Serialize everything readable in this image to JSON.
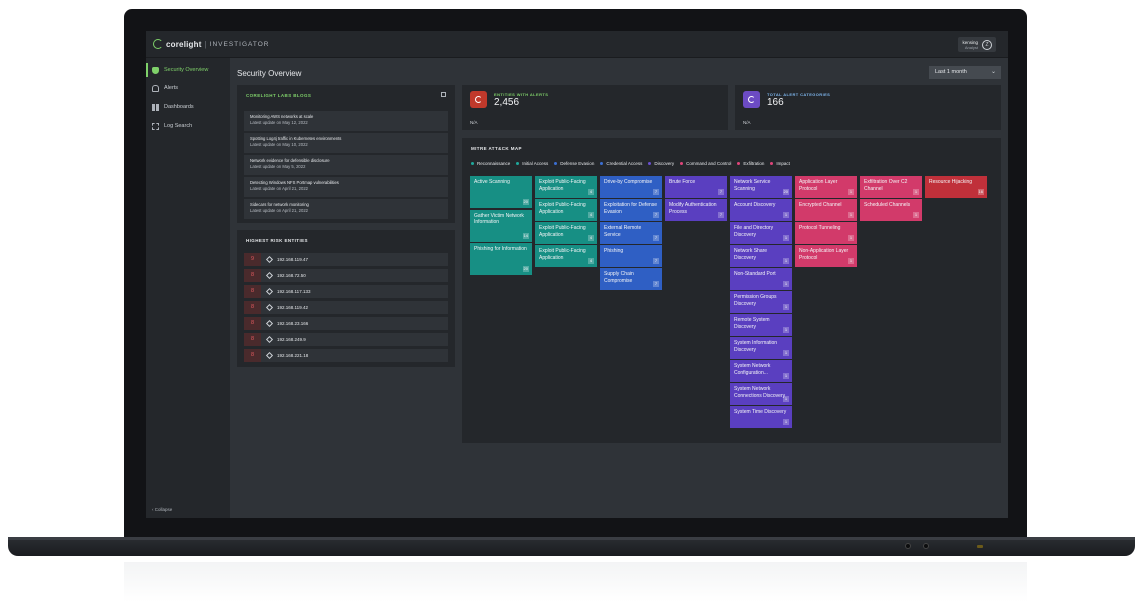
{
  "app": {
    "brand": "corelight",
    "product": "INVESTIGATOR",
    "user": {
      "name": "kensing",
      "role": "Analyst",
      "avatar_letter": "Z"
    }
  },
  "sidebar": {
    "items": [
      {
        "label": "Security Overview",
        "icon": "shield-icon",
        "active": true
      },
      {
        "label": "Alerts",
        "icon": "bell-icon",
        "active": false
      },
      {
        "label": "Dashboards",
        "icon": "grid-icon",
        "active": false
      },
      {
        "label": "Log Search",
        "icon": "search-icon",
        "active": false
      }
    ],
    "collapse_label": "Collapse"
  },
  "page": {
    "title": "Security Overview",
    "range": "Last 1 month"
  },
  "blogs": {
    "title": "CORELIGHT LABS BLOGS",
    "items": [
      {
        "title": "Monitoring AWS networks at scale",
        "date": "Latest update on May 12, 2022"
      },
      {
        "title": "Spotting Log4j traffic in Kubernetes environments",
        "date": "Latest update on May 10, 2022"
      },
      {
        "title": "Network evidence for defensible disclosure",
        "date": "Latest update on May 5, 2022"
      },
      {
        "title": "Detecting Windows NFS Portmap vulnerabilities",
        "date": "Latest update on April 21, 2022"
      },
      {
        "title": "Sidecars for network monitoring",
        "date": "Latest update on April 21, 2022"
      }
    ]
  },
  "risk": {
    "title": "HIGHEST RISK ENTITIES",
    "items": [
      {
        "score": "9",
        "ip": "192.168.119.47"
      },
      {
        "score": "8",
        "ip": "192.168.72.50"
      },
      {
        "score": "8",
        "ip": "192.168.117.133"
      },
      {
        "score": "8",
        "ip": "192.168.119.42"
      },
      {
        "score": "8",
        "ip": "192.168.23.166"
      },
      {
        "score": "8",
        "ip": "192.168.249.9"
      },
      {
        "score": "8",
        "ip": "192.168.221.18"
      }
    ]
  },
  "stats": {
    "entities": {
      "label": "ENTITIES WITH ALERTS",
      "value": "2,456",
      "foot": "N/A",
      "color": "#c0392b"
    },
    "categories": {
      "label": "TOTAL ALERT CATEGORIES",
      "value": "166",
      "foot": "N/A",
      "color": "#6c4bc4"
    }
  },
  "mitre": {
    "title": "MITRE ATT&CK MAP",
    "legend": [
      {
        "label": "Reconnaissance",
        "color": "#1fa99c"
      },
      {
        "label": "Initial Access",
        "color": "#1fa99c"
      },
      {
        "label": "Defense Evasion",
        "color": "#3b6fd4"
      },
      {
        "label": "Credential Access",
        "color": "#3b6fd4"
      },
      {
        "label": "Discovery",
        "color": "#6a4fd0"
      },
      {
        "label": "Command and Control",
        "color": "#e0457a"
      },
      {
        "label": "Exfiltration",
        "color": "#e0457a"
      },
      {
        "label": "Impact",
        "color": "#e0457a"
      }
    ],
    "columns": [
      {
        "color": "#178f84",
        "tiles": [
          {
            "label": "Active Scanning",
            "count": "20",
            "tall": true
          },
          {
            "label": "Gather Victim Network Information",
            "count": "14",
            "tall": true
          },
          {
            "label": "Phishing for Information",
            "count": "20",
            "tall": true
          }
        ]
      },
      {
        "color": "#178f84",
        "tiles": [
          {
            "label": "Exploit Public-Facing Application",
            "count": "4"
          },
          {
            "label": "Exploit Public-Facing Application",
            "count": "4"
          },
          {
            "label": "Exploit Public-Facing Application",
            "count": "4"
          },
          {
            "label": "Exploit Public-Facing Application",
            "count": "4"
          }
        ]
      },
      {
        "color": "#2f5fc4",
        "tiles": [
          {
            "label": "Drive-by Compromise",
            "count": "7"
          },
          {
            "label": "Exploitation for Defense Evasion",
            "count": "7"
          },
          {
            "label": "External Remote Service",
            "count": "7"
          },
          {
            "label": "Phishing",
            "count": "7"
          },
          {
            "label": "Supply Chain Compromise",
            "count": "7"
          }
        ]
      },
      {
        "color": "#5a3fc0",
        "tiles": [
          {
            "label": "Brute Force",
            "count": "7"
          },
          {
            "label": "Modify Authentication Process",
            "count": "7"
          }
        ]
      },
      {
        "color": "#5a3fc0",
        "tiles": [
          {
            "label": "Network Service Scanning",
            "count": "20"
          },
          {
            "label": "Account Discovery",
            "count": "1"
          },
          {
            "label": "File and Directory Discovery",
            "count": "1"
          },
          {
            "label": "Network Share Discovery",
            "count": "1"
          },
          {
            "label": "Non-Standard Port",
            "count": "1"
          },
          {
            "label": "Permission Groups Discovery",
            "count": "1"
          },
          {
            "label": "Remote System Discovery",
            "count": "1"
          },
          {
            "label": "System Information Discovery",
            "count": "1"
          },
          {
            "label": "System Network Configuration...",
            "count": "1"
          },
          {
            "label": "System Network Connections Discovery",
            "count": "1"
          },
          {
            "label": "System Time Discovery",
            "count": "1"
          }
        ]
      },
      {
        "color": "#d23a6a",
        "tiles": [
          {
            "label": "Application Layer Protocol",
            "count": "1"
          },
          {
            "label": "Encrypted Channel",
            "count": "1"
          },
          {
            "label": "Protocol Tunneling",
            "count": "1"
          },
          {
            "label": "Non-Application Layer Protocol",
            "count": "1"
          }
        ]
      },
      {
        "color": "#d23a6a",
        "tiles": [
          {
            "label": "Exfiltration Over C2 Channel",
            "count": "1"
          },
          {
            "label": "Scheduled Channels",
            "count": "1"
          }
        ]
      },
      {
        "color": "#c0303a",
        "tiles": [
          {
            "label": "Resource Hijacking",
            "count": "16"
          }
        ]
      }
    ]
  }
}
